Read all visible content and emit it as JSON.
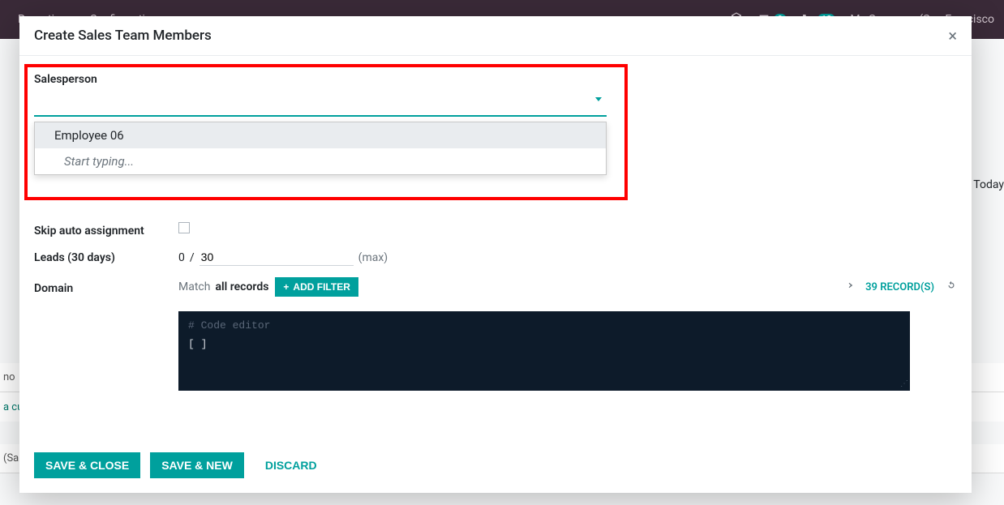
{
  "nav": {
    "link1": "Reporting",
    "link2": "Configuration",
    "badge1": "9",
    "badge2": "13",
    "company": "My Company (San Francisco"
  },
  "background": {
    "today": "Today",
    "row_no": "no",
    "row_cu": "a cu",
    "row_sa": "(Sa"
  },
  "modal": {
    "title": "Create Sales Team Members",
    "close": "×"
  },
  "fields": {
    "salesperson_label": "Salesperson",
    "salesperson_value": "",
    "dropdown_option": "Employee 06",
    "dropdown_hint": "Start typing...",
    "skip_label": "Skip auto assignment",
    "leads_label": "Leads (30 days)",
    "leads_current": "0",
    "leads_sep": "/",
    "leads_max_value": "30",
    "leads_max_suffix": "(max)",
    "domain_label": "Domain",
    "match_prefix": "Match",
    "match_scope": "all records",
    "add_filter": "ADD FILTER",
    "records_count": "39 RECORD(S)",
    "code_comment": "# Code editor",
    "code_body": "[ ]"
  },
  "footer": {
    "save_close": "SAVE & CLOSE",
    "save_new": "SAVE & NEW",
    "discard": "DISCARD"
  }
}
